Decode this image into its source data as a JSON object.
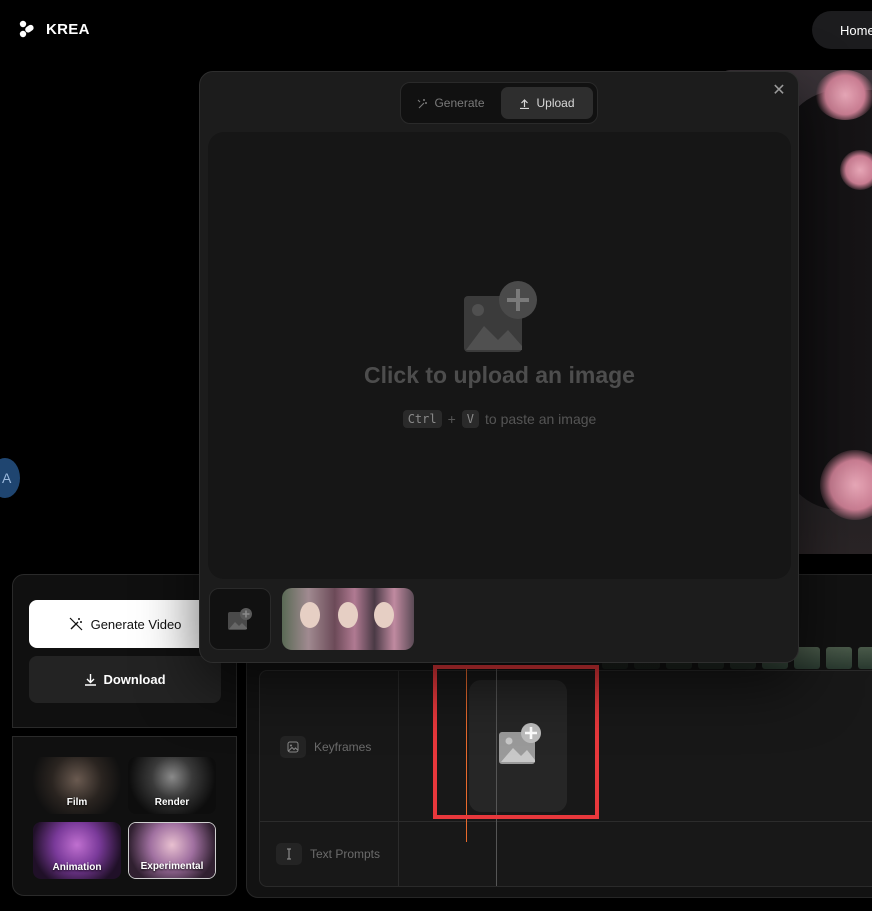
{
  "header": {
    "logo_text": "KREA",
    "home_label": "Home"
  },
  "help_bubble": {
    "text": "A"
  },
  "left_panel": {
    "generate_video_label": "Generate Video",
    "download_label": "Download"
  },
  "styles": [
    {
      "label": "Film",
      "active": false
    },
    {
      "label": "Render",
      "active": false
    },
    {
      "label": "Animation",
      "active": false
    },
    {
      "label": "Experimental",
      "active": true
    }
  ],
  "timeline": {
    "keyframes_label": "Keyframes",
    "text_prompts_label": "Text Prompts"
  },
  "modal": {
    "tabs": [
      {
        "label": "Generate",
        "active": false
      },
      {
        "label": "Upload",
        "active": true
      }
    ],
    "drop_title": "Click to upload an image",
    "hint_key1": "Ctrl",
    "hint_plus": "+",
    "hint_key2": "V",
    "hint_text": "to paste an image"
  },
  "colors": {
    "annotation": "#e8383c",
    "playhead": "#e86a2c"
  }
}
